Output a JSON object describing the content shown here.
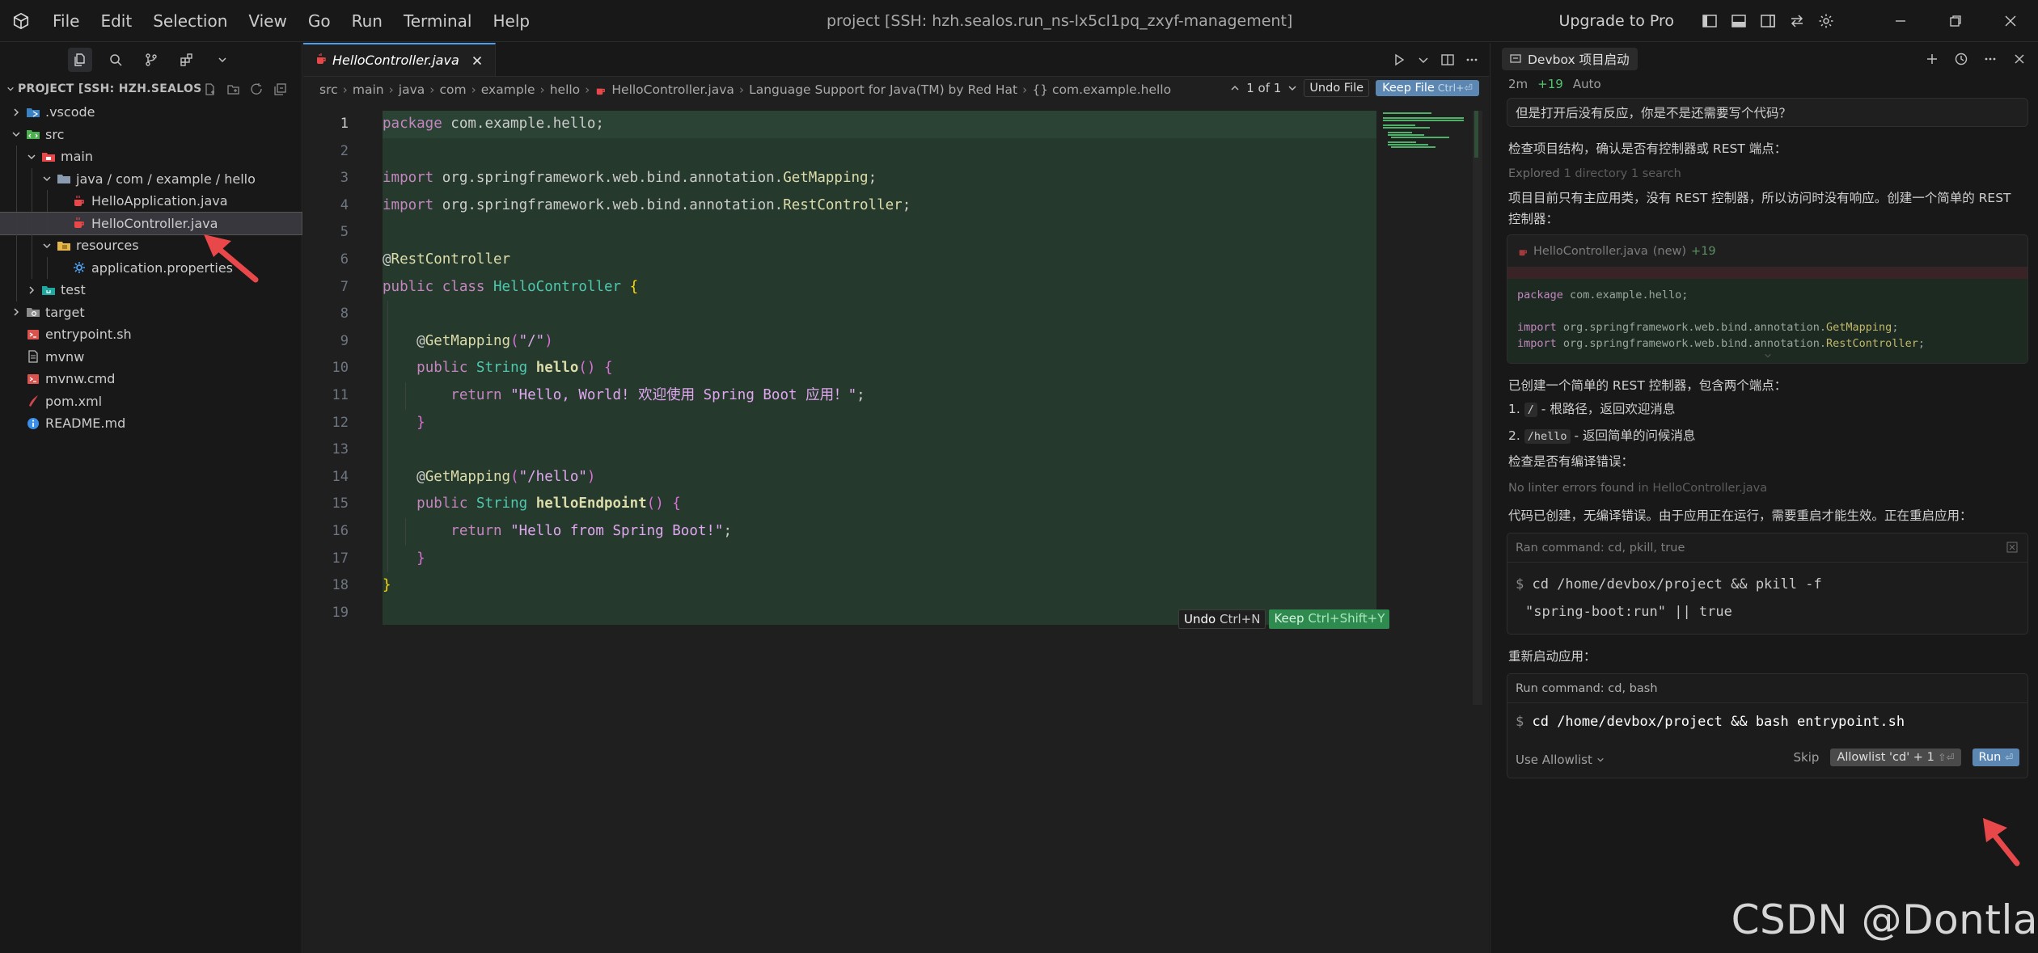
{
  "menu": [
    "File",
    "Edit",
    "Selection",
    "View",
    "Go",
    "Run",
    "Terminal",
    "Help"
  ],
  "window_title": "project [SSH: hzh.sealos.run_ns-lx5cl1pq_zxyf-management]",
  "upgrade_label": "Upgrade to Pro",
  "explorer": {
    "project_header": "PROJECT [SSH: HZH.SEALOS.R...",
    "tree": [
      {
        "label": ".vscode",
        "depth": 0,
        "kind": "folder",
        "icon": "vscode-folder-icon",
        "open": false
      },
      {
        "label": "src",
        "depth": 0,
        "kind": "folder",
        "icon": "src-folder-icon",
        "open": true
      },
      {
        "label": "main",
        "depth": 1,
        "kind": "folder",
        "icon": "main-folder-icon",
        "open": true
      },
      {
        "label": "java / com / example / hello",
        "depth": 2,
        "kind": "folder",
        "icon": "folder-icon",
        "open": true
      },
      {
        "label": "HelloApplication.java",
        "depth": 3,
        "kind": "file",
        "icon": "java-file-icon"
      },
      {
        "label": "HelloController.java",
        "depth": 3,
        "kind": "file",
        "icon": "java-file-icon",
        "selected": true
      },
      {
        "label": "resources",
        "depth": 2,
        "kind": "folder",
        "icon": "resources-folder-icon",
        "open": true
      },
      {
        "label": "application.properties",
        "depth": 3,
        "kind": "file",
        "icon": "gear-file-icon"
      },
      {
        "label": "test",
        "depth": 1,
        "kind": "folder",
        "icon": "test-folder-icon",
        "open": false
      },
      {
        "label": "target",
        "depth": 0,
        "kind": "folder",
        "icon": "target-folder-icon",
        "open": false
      },
      {
        "label": "entrypoint.sh",
        "depth": 0,
        "kind": "file",
        "icon": "shell-file-icon"
      },
      {
        "label": "mvnw",
        "depth": 0,
        "kind": "file",
        "icon": "file-icon"
      },
      {
        "label": "mvnw.cmd",
        "depth": 0,
        "kind": "file",
        "icon": "shell-file-icon"
      },
      {
        "label": "pom.xml",
        "depth": 0,
        "kind": "file",
        "icon": "maven-file-icon"
      },
      {
        "label": "README.md",
        "depth": 0,
        "kind": "file",
        "icon": "info-file-icon"
      }
    ]
  },
  "editor": {
    "tab_label": "HelloController.java",
    "breadcrumb": [
      "src",
      "main",
      "java",
      "com",
      "example",
      "hello",
      "HelloController.java",
      "Language Support for Java(TM) by Red Hat",
      "{} com.example.hello"
    ],
    "diff_nav": "1 of 1",
    "undo_file": "Undo File",
    "keep_file": "Keep File",
    "keep_file_kb": "Ctrl+⏎",
    "inline_undo": "Undo",
    "inline_undo_kb": "Ctrl+N",
    "inline_keep": "Keep",
    "inline_keep_kb": "Ctrl+Shift+Y",
    "line_numbers": [
      "1",
      "2",
      "3",
      "4",
      "5",
      "6",
      "7",
      "8",
      "9",
      "10",
      "11",
      "12",
      "13",
      "14",
      "15",
      "16",
      "17",
      "18",
      "19"
    ]
  },
  "chat": {
    "tab_title": "Devbox 项目启动",
    "meta_time": "2m",
    "meta_plus": "+19",
    "meta_mode": "Auto",
    "user_message": "但是打开后没有反应，你是不是还需要写个代码？",
    "p1": "检查项目结构，确认是否有控制器或 REST 端点：",
    "explored": "Explored",
    "explored_detail": "1 directory 1 search",
    "p2": "项目目前只有主应用类，没有 REST 控制器，所以访问时没有响应。创建一个简单的 REST 控制器：",
    "card_file": "HelloController.java",
    "card_new": "(new)",
    "card_plus": "+19",
    "card_lines": [
      "package com.example.hello;",
      "",
      "import org.springframework.web.bind.annotation.GetMapping;",
      "import org.springframework.web.bind.annotation.RestController;"
    ],
    "p3": "已创建一个简单的 REST 控制器，包含两个端点：",
    "li1_num": "1.",
    "li1_code": "/",
    "li1_text": " - 根路径，返回欢迎消息",
    "li2_num": "2.",
    "li2_code": "/hello",
    "li2_text": " - 返回简单的问候消息",
    "p4": "检查是否有编译错误：",
    "lint": "No linter errors found",
    "lint_in": "in HelloController.java",
    "p5": "代码已创建，无编译错误。由于应用正在运行，需要重启才能生效。正在重启应用：",
    "term1_title": "Ran command: cd, pkill, true",
    "term1_line1": "cd /home/devbox/project && pkill -f",
    "term1_line2": "\"spring-boot:run\" || true",
    "p6": "重新启动应用：",
    "term2_title": "Run command: cd, bash",
    "term2_cmd": "cd /home/devbox/project && bash entrypoint.sh",
    "use_allowlist": "Use Allowlist",
    "skip": "Skip",
    "allowlist_btn": "Allowlist 'cd' + 1",
    "allowlist_kb": "⇧⏎",
    "run_btn": "Run",
    "run_kb": "⏎"
  },
  "watermark": "CSDN @Dontla",
  "colors": {
    "accent": "#4da0f0",
    "keep": "#5b87b2",
    "diff_add": "#26392d",
    "arrow": "#e8484a"
  }
}
